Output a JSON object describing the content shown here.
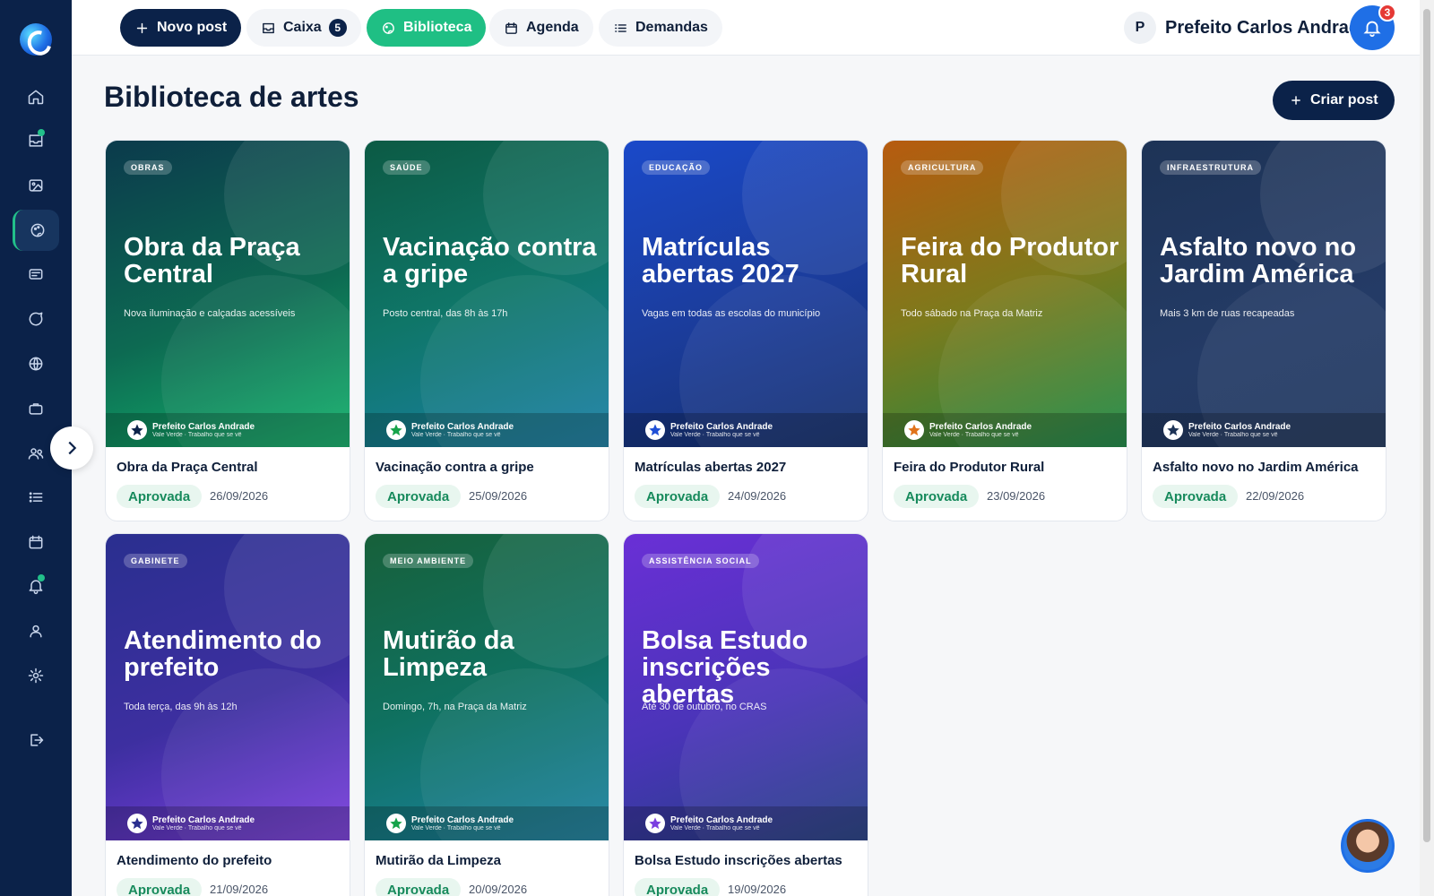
{
  "topbar": {
    "new_post": "Novo post",
    "caixa": "Caixa",
    "caixa_count": "5",
    "biblioteca": "Biblioteca",
    "agenda": "Agenda",
    "demandas": "Demandas",
    "user_initial": "P",
    "user_name": "Prefeito Carlos Andrade",
    "notif_count": "3"
  },
  "page": {
    "title": "Biblioteca de artes",
    "create_button": "Criar post"
  },
  "cards": [
    {
      "tag": "OBRAS",
      "art_title": "Obra da Praça Central",
      "art_sub": "Nova iluminação e calçadas acessíveis",
      "footer_name": "Prefeito Carlos Andrade",
      "footer_sub": "Vale Verde · Trabalho que se vê",
      "title": "Obra da Praça Central",
      "status": "Aprovada",
      "date": "26/09/2026",
      "theme": "obras",
      "star_color": "#0b2249"
    },
    {
      "tag": "SAÚDE",
      "art_title": "Vacinação contra a gripe",
      "art_sub": "Posto central, das 8h às 17h",
      "footer_name": "Prefeito Carlos Andrade",
      "footer_sub": "Vale Verde · Trabalho que se vê",
      "title": "Vacinação contra a gripe",
      "status": "Aprovada",
      "date": "25/09/2026",
      "theme": "saude",
      "star_color": "#16a34a"
    },
    {
      "tag": "EDUCAÇÃO",
      "art_title": "Matrículas abertas 2027",
      "art_sub": "Vagas em todas as escolas do município",
      "footer_name": "Prefeito Carlos Andrade",
      "footer_sub": "Vale Verde · Trabalho que se vê",
      "title": "Matrículas abertas 2027",
      "status": "Aprovada",
      "date": "24/09/2026",
      "theme": "edu",
      "star_color": "#1f4fd6"
    },
    {
      "tag": "AGRICULTURA",
      "art_title": "Feira do Produtor Rural",
      "art_sub": "Todo sábado na Praça da Matriz",
      "footer_name": "Prefeito Carlos Andrade",
      "footer_sub": "Vale Verde · Trabalho que se vê",
      "title": "Feira do Produtor Rural",
      "status": "Aprovada",
      "date": "23/09/2026",
      "theme": "agri",
      "star_color": "#e0721a"
    },
    {
      "tag": "INFRAESTRUTURA",
      "art_title": "Asfalto novo no Jardim América",
      "art_sub": "Mais 3 km de ruas recapeadas",
      "footer_name": "Prefeito Carlos Andrade",
      "footer_sub": "Vale Verde · Trabalho que se vê",
      "title": "Asfalto novo no Jardim América",
      "status": "Aprovada",
      "date": "22/09/2026",
      "theme": "infra",
      "star_color": "#1d3356"
    },
    {
      "tag": "GABINETE",
      "art_title": "Atendimento do prefeito",
      "art_sub": "Toda terça, das 9h às 12h",
      "footer_name": "Prefeito Carlos Andrade",
      "footer_sub": "Vale Verde · Trabalho que se vê",
      "title": "Atendimento do prefeito",
      "status": "Aprovada",
      "date": "21/09/2026",
      "theme": "gab",
      "star_color": "#2a2f8f"
    },
    {
      "tag": "MEIO AMBIENTE",
      "art_title": "Mutirão da Limpeza",
      "art_sub": "Domingo, 7h, na Praça da Matriz",
      "footer_name": "Prefeito Carlos Andrade",
      "footer_sub": "Vale Verde · Trabalho que se vê",
      "title": "Mutirão da Limpeza",
      "status": "Aprovada",
      "date": "20/09/2026",
      "theme": "meio",
      "star_color": "#16a34a"
    },
    {
      "tag": "ASSISTÊNCIA SOCIAL",
      "art_title": "Bolsa Estudo inscrições abertas",
      "art_sub": "Até 30 de outubro, no CRAS",
      "footer_name": "Prefeito Carlos Andrade",
      "footer_sub": "Vale Verde · Trabalho que se vê",
      "title": "Bolsa Estudo inscrições abertas",
      "status": "Aprovada",
      "date": "19/09/2026",
      "theme": "assist",
      "star_color": "#7c3fe0"
    }
  ],
  "sidebar": {
    "items": [
      "home-icon",
      "inbox-icon",
      "image-icon",
      "palette-icon",
      "newspaper-icon",
      "chat-icon",
      "globe-icon",
      "briefcase-icon",
      "users-icon",
      "list-icon",
      "calendar-icon",
      "bell-icon",
      "user-icon",
      "settings-icon",
      "logout-icon"
    ],
    "active": "palette-icon"
  },
  "colors": {
    "sidebar": "#0b2249",
    "accent": "#1fbf84",
    "primary": "#0b2249"
  }
}
